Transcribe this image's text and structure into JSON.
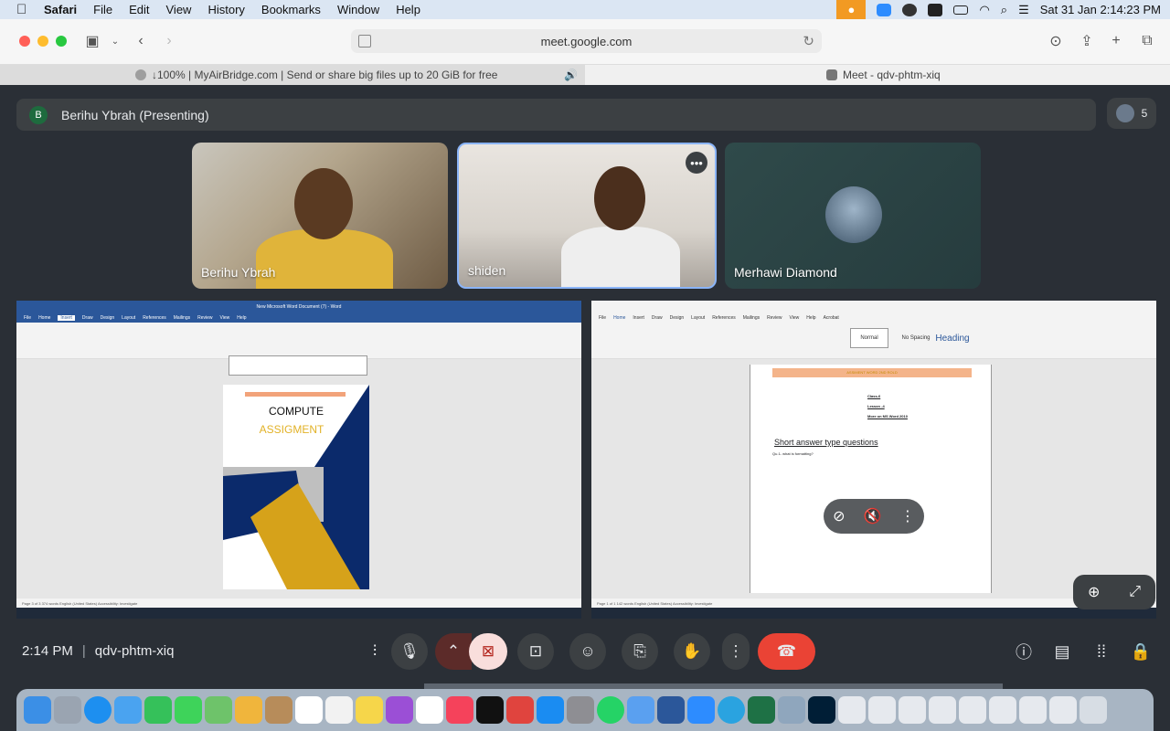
{
  "menubar": {
    "app": "Safari",
    "items": [
      "File",
      "Edit",
      "View",
      "History",
      "Bookmarks",
      "Window",
      "Help"
    ],
    "clock": "Sat 31 Jan  2:14:23 PM"
  },
  "browser": {
    "url": "meet.google.com",
    "tabs": [
      {
        "title": "↓100% | MyAirBridge.com | Send or share big files up to 20 GiB for free"
      },
      {
        "title": "Meet - qdv-phtm-xiq"
      }
    ]
  },
  "meet": {
    "presenter": {
      "initial": "B",
      "label": "Berihu Ybrah (Presenting)"
    },
    "participant_count": "5",
    "tiles": [
      {
        "name": "Berihu Ybrah"
      },
      {
        "name": "shiden"
      },
      {
        "name": "Merhawi Diamond"
      }
    ],
    "share_left": {
      "doc_title": "New Microsoft Word Document (7) - Word",
      "cover_line1": "COMPUTE",
      "cover_line2": "ASSIGMENT",
      "status": "Page 3 of 3   374 words   English (United States)   Accessibility: Investigate",
      "ribbon_tabs": [
        "File",
        "Home",
        "Insert",
        "Draw",
        "Design",
        "Layout",
        "References",
        "Mailings",
        "Review",
        "View",
        "Help"
      ]
    },
    "share_right": {
      "header_bar": "ASSIMENT WORD 2ND ROLD",
      "lines": [
        "Class-6",
        "Lesson -4",
        "More on MS Word 2010"
      ],
      "heading": "Short answer type questions",
      "question": "Qu.1- what is formatting?",
      "styles": [
        "Normal",
        "No Spacing",
        "Heading"
      ],
      "ribbon_tabs": [
        "File",
        "Home",
        "Insert",
        "Draw",
        "Design",
        "Layout",
        "References",
        "Mailings",
        "Review",
        "View",
        "Help",
        "Acrobat"
      ],
      "status": "Page 1 of 1   142 words   English (United States)   Accessibility: Investigate"
    },
    "bottom": {
      "time": "2:14 PM",
      "code": "qdv-phtm-xiq"
    }
  },
  "colors": {
    "meet_bg": "#2a2f36",
    "end_call": "#ea4335",
    "presenter_avatar": "#1e6b3e",
    "word_blue": "#2b579a"
  }
}
